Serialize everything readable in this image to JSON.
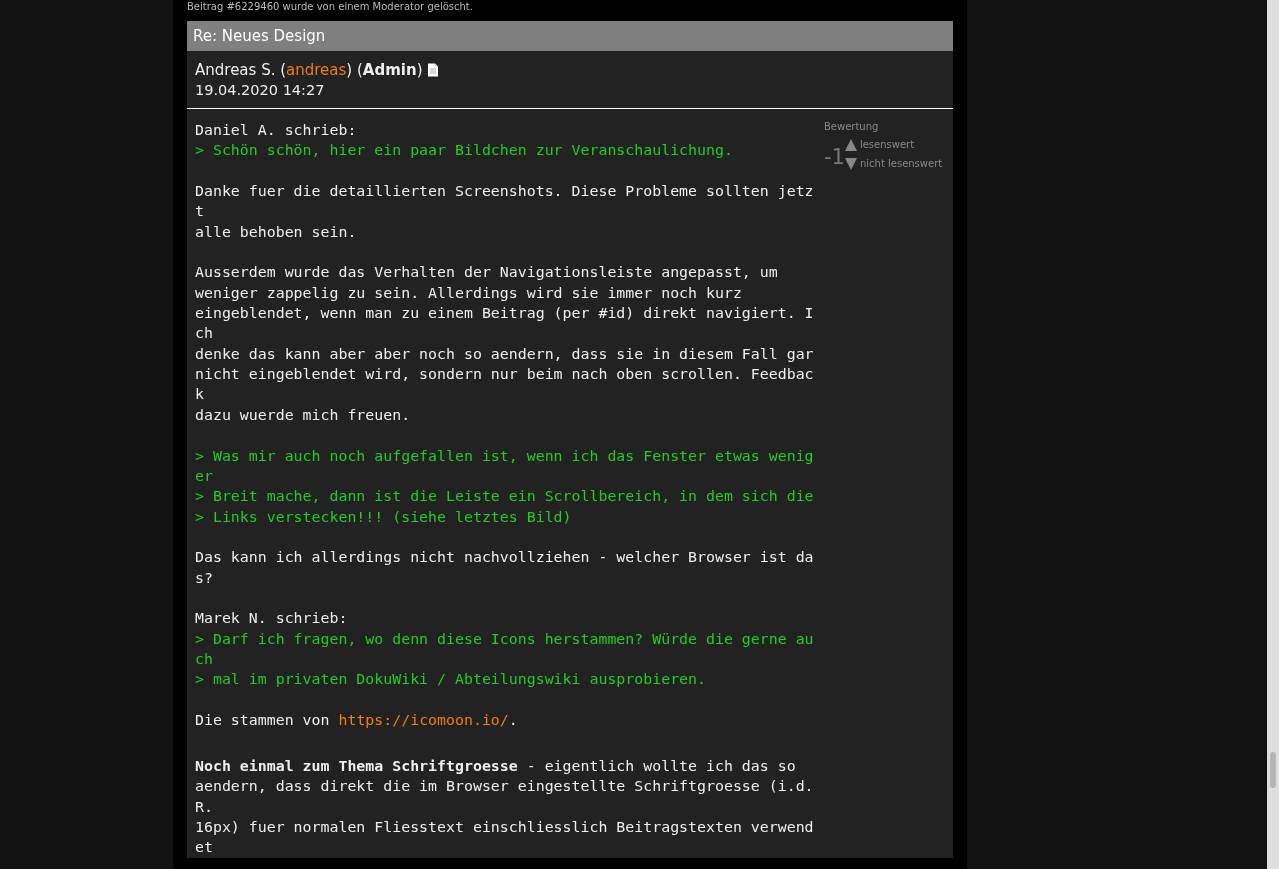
{
  "notice": "Beitrag #6229460 wurde von einem Moderator gelöscht.",
  "post": {
    "title": "Re: Neues Design",
    "author": {
      "name": "Andreas S. (",
      "username": "andreas",
      "between": ") (",
      "role": "Admin",
      "after": ")"
    },
    "date": "19.04.2020 14:27",
    "rating": {
      "label": "Bewertung",
      "score": "-1",
      "up": "lesenswert",
      "down": "nicht lesenswert"
    },
    "lines": [
      {
        "kind": "plain",
        "text": "Daniel A. schrieb:"
      },
      {
        "kind": "quote",
        "text": "> Schön schön, hier ein paar Bildchen zur Veranschaulichung."
      },
      {
        "kind": "blank"
      },
      {
        "kind": "plain",
        "text": "Danke fuer die detaillierten Screenshots. Diese Probleme sollten jetz"
      },
      {
        "kind": "plain",
        "text": "t"
      },
      {
        "kind": "plain",
        "text": "alle behoben sein."
      },
      {
        "kind": "blank"
      },
      {
        "kind": "plain",
        "text": "Ausserdem wurde das Verhalten der Navigationsleiste angepasst, um"
      },
      {
        "kind": "plain",
        "text": "weniger zappelig zu sein. Allerdings wird sie immer noch kurz"
      },
      {
        "kind": "plain",
        "text": "eingeblendet, wenn man zu einem Beitrag (per #id) direkt navigiert. I"
      },
      {
        "kind": "plain",
        "text": "ch"
      },
      {
        "kind": "plain",
        "text": "denke das kann aber aber noch so aendern, dass sie in diesem Fall gar"
      },
      {
        "kind": "plain",
        "text": "nicht eingeblendet wird, sondern nur beim nach oben scrollen. Feedbac"
      },
      {
        "kind": "plain",
        "text": "k"
      },
      {
        "kind": "plain",
        "text": "dazu wuerde mich freuen."
      },
      {
        "kind": "blank"
      },
      {
        "kind": "quote",
        "text": "> Was mir auch noch aufgefallen ist, wenn ich das Fenster etwas wenig"
      },
      {
        "kind": "quote",
        "text": "er"
      },
      {
        "kind": "quote",
        "text": "> Breit mache, dann ist die Leiste ein Scrollbereich, in dem sich die"
      },
      {
        "kind": "quote",
        "text": "> Links verstecken!!! (siehe letztes Bild)"
      },
      {
        "kind": "blank"
      },
      {
        "kind": "plain",
        "text": "Das kann ich allerdings nicht nachvollziehen - welcher Browser ist da"
      },
      {
        "kind": "plain",
        "text": "s?"
      },
      {
        "kind": "blank"
      },
      {
        "kind": "plain",
        "text": "Marek N. schrieb:"
      },
      {
        "kind": "quote",
        "text": "> Darf ich fragen, wo denn diese Icons herstammen? Würde die gerne au"
      },
      {
        "kind": "quote",
        "text": "ch"
      },
      {
        "kind": "quote",
        "text": "> mal im privaten DokuWiki / Abteilungswiki ausprobieren."
      },
      {
        "kind": "blank"
      },
      {
        "kind": "link",
        "text": "Die stammen von ",
        "link": "https://icomoon.io/",
        "after": "."
      },
      {
        "kind": "spacer"
      },
      {
        "kind": "plain",
        "text": "**Noch einmal zum Thema Schriftgroesse** - eigentlich wollte ich das so"
      },
      {
        "kind": "plain",
        "text": "aendern, dass direkt die im Browser eingestellte Schriftgroesse (i.d."
      },
      {
        "kind": "plain",
        "text": "R."
      },
      {
        "kind": "plain",
        "text": "16px) fuer normalen Fliesstext einschliesslich Beitragstexten verwend"
      },
      {
        "kind": "plain",
        "text": "et"
      }
    ]
  }
}
